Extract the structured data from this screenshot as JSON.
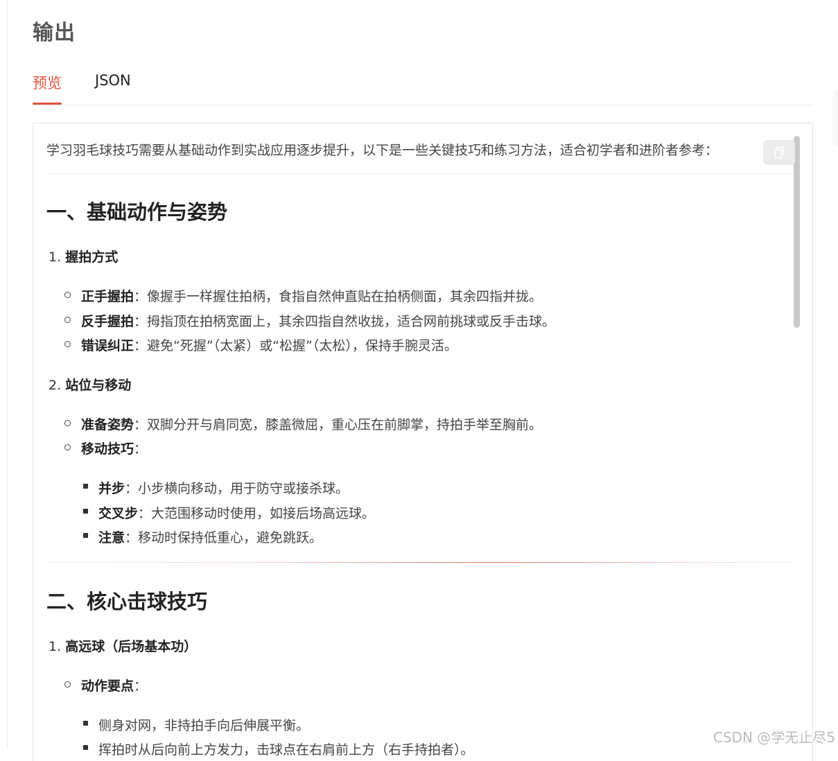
{
  "header": {
    "title": "输出"
  },
  "tabs": [
    {
      "label": "预览"
    },
    {
      "label": "JSON"
    }
  ],
  "content": {
    "intro": "学习羽毛球技巧需要从基础动作到实战应用逐步提升，以下是一些关键技巧和练习方法，适合初学者和进阶者参考：",
    "section1": {
      "heading": "一、基础动作与姿势",
      "item1": {
        "num": "1.",
        "title": "握拍方式",
        "bullets": [
          {
            "term": "正手握拍",
            "sep": "：",
            "text": "像握手一样握住拍柄，食指自然伸直贴在拍柄侧面，其余四指并拢。"
          },
          {
            "term": "反手握拍",
            "sep": "：",
            "text": "拇指顶在拍柄宽面上，其余四指自然收拢，适合网前挑球或反手击球。"
          },
          {
            "term": "错误纠正",
            "sep": "：",
            "text": "避免“死握”（太紧）或“松握”（太松），保持手腕灵活。"
          }
        ]
      },
      "item2": {
        "num": "2.",
        "title": "站位与移动",
        "bullets": [
          {
            "term": "准备姿势",
            "sep": "：",
            "text": "双脚分开与肩同宽，膝盖微屈，重心压在前脚掌，持拍手举至胸前。"
          },
          {
            "term": "移动技巧",
            "sep": "：",
            "text": ""
          }
        ],
        "sub": [
          {
            "term": "并步",
            "sep": "：",
            "text": "小步横向移动，用于防守或接杀球。"
          },
          {
            "term": "交叉步",
            "sep": "：",
            "text": "大范围移动时使用，如接后场高远球。"
          },
          {
            "term": "注意",
            "sep": "：",
            "text": "移动时保持低重心，避免跳跃。"
          }
        ]
      }
    },
    "section2": {
      "heading": "二、核心击球技巧",
      "item1": {
        "num": "1.",
        "title": "高远球（后场基本功）",
        "bullets": [
          {
            "term": "动作要点",
            "sep": "：",
            "text": ""
          }
        ],
        "sub": [
          {
            "text": "侧身对网，非持拍手向后伸展平衡。"
          },
          {
            "text": "挥拍时从后向前上方发力，击球点在右肩前上方（右手持拍者）。"
          }
        ]
      }
    }
  },
  "watermark": "CSDN @学无止尽5",
  "colors": {
    "accent": "#e0533a"
  },
  "icons": {
    "copy": "copy-icon"
  }
}
